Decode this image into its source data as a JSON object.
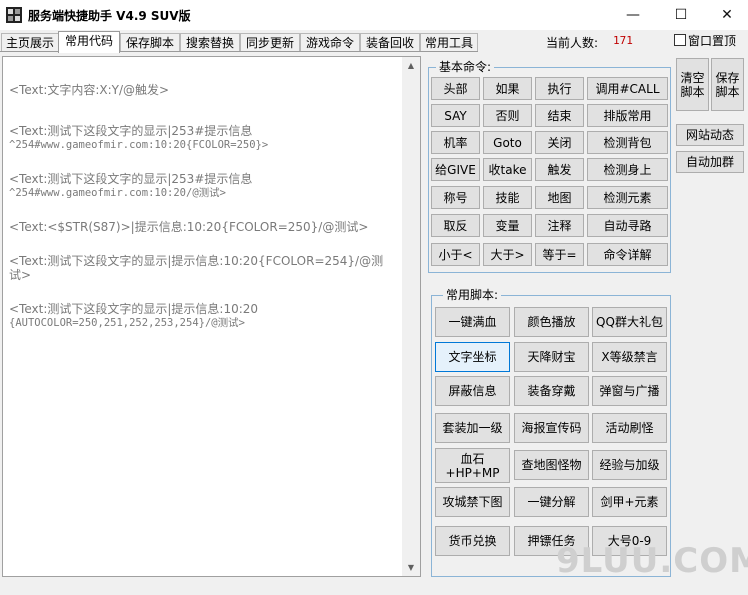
{
  "window": {
    "title": "服务端快捷助手 V4.9 SUV版",
    "minimize": "—",
    "maximize": "☐",
    "close": "✕"
  },
  "tabs": [
    "主页展示",
    "常用代码",
    "保存脚本",
    "搜索替换",
    "同步更新",
    "游戏命令",
    "装备回收",
    "常用工具"
  ],
  "active_tab": "常用代码",
  "status": {
    "online_label": "当前人数:",
    "online_count": "171",
    "pin_label": "窗口置顶",
    "pin_checked": false
  },
  "editor": {
    "lines": [
      "<Text:文字内容:X:Y/@触发>",
      "<Text:测试下这段文字的显示|253#提示信息",
      "^254#www.gameofmir.com:10:20{FCOLOR=250}>",
      "<Text:测试下这段文字的显示|253#提示信息",
      "^254#www.gameofmir.com:10:20/@测试>",
      "<Text:<$STR(S87)>|提示信息:10:20{FCOLOR=250}/@测试>",
      "<Text:测试下这段文字的显示|提示信息:10:20{FCOLOR=254}/@测",
      "试>",
      "<Text:测试下这段文字的显示|提示信息:10:20",
      "{AUTOCOLOR=250,251,252,253,254}/@测试>"
    ]
  },
  "basic_commands": {
    "legend": "基本命令:",
    "buttons": [
      "头部",
      "如果",
      "执行",
      "调用#CALL",
      "SAY",
      "否则",
      "结束",
      "排版常用",
      "机率",
      "Goto",
      "关闭",
      "检测背包",
      "给GIVE",
      "收take",
      "触发",
      "检测身上",
      "称号",
      "技能",
      "地图",
      "检测元素",
      "取反",
      "变量",
      "注释",
      "自动寻路",
      "小于<",
      "大于>",
      "等于=",
      "命令详解"
    ]
  },
  "side_buttons": {
    "clear": "清空\n脚本",
    "save": "保存\n脚本",
    "site_news": "网站动态",
    "auto_join": "自动加群"
  },
  "common_scripts": {
    "legend": "常用脚本:",
    "buttons": [
      "一键满血",
      "颜色播放",
      "QQ群大礼包",
      "文字坐标",
      "天降财宝",
      "X等级禁言",
      "屏蔽信息",
      "装备穿戴",
      "弹窗与广播",
      "套装加一级",
      "海报宣传码",
      "活动刷怪",
      "血石\n+HP+MP",
      "查地图怪物",
      "经验与加级",
      "攻城禁下图",
      "一键分解",
      "剑甲+元素",
      "货币兑换",
      "押镖任务",
      "大号0-9"
    ],
    "selected": "文字坐标"
  },
  "watermark": "9LUU.COM"
}
